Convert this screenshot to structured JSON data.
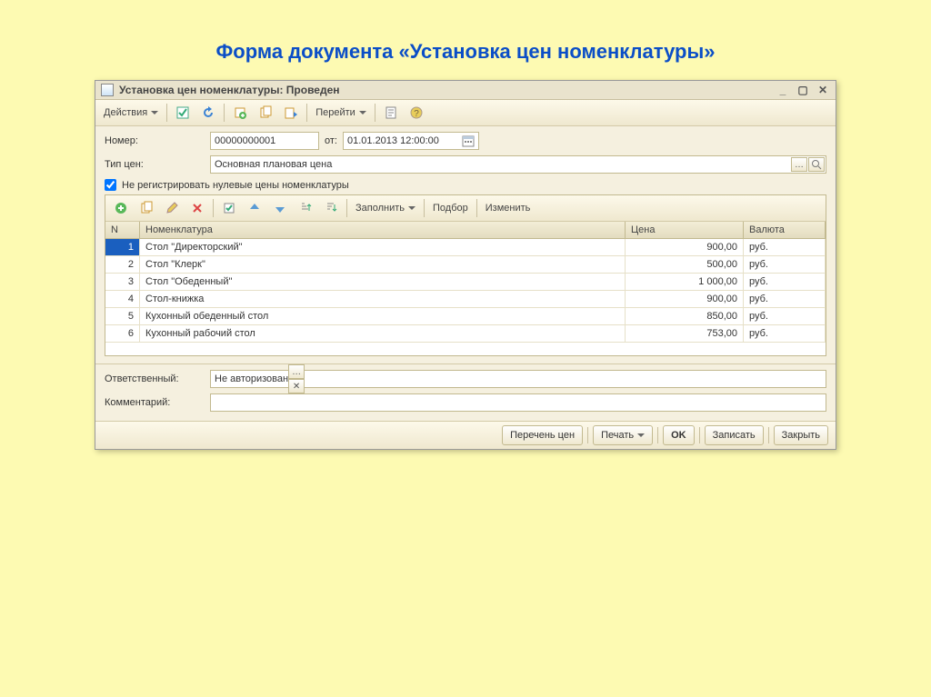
{
  "caption": "Форма документа «Установка цен номенклатуры»",
  "window": {
    "title": "Установка цен номенклатуры: Проведен"
  },
  "toolbar": {
    "actions": "Действия",
    "goto": "Перейти"
  },
  "fields": {
    "number_label": "Номер:",
    "number_value": "00000000001",
    "from_label": "от:",
    "date_value": "01.01.2013 12:00:00",
    "pricetype_label": "Тип цен:",
    "pricetype_value": "Основная плановая цена",
    "nozeroprices_label": "Не регистрировать нулевые цены номенклатуры",
    "responsible_label": "Ответственный:",
    "responsible_value": "Не авторизован",
    "comment_label": "Комментарий:",
    "comment_value": ""
  },
  "grid_toolbar": {
    "fill": "Заполнить",
    "select": "Подбор",
    "change": "Изменить"
  },
  "grid": {
    "columns": {
      "n": "N",
      "item": "Номенклатура",
      "price": "Цена",
      "currency": "Валюта"
    },
    "rows": [
      {
        "n": "1",
        "item": "Стол \"Директорский\"",
        "price": "900,00",
        "currency": "руб."
      },
      {
        "n": "2",
        "item": "Стол \"Клерк\"",
        "price": "500,00",
        "currency": "руб."
      },
      {
        "n": "3",
        "item": "Стол \"Обеденный\"",
        "price": "1 000,00",
        "currency": "руб."
      },
      {
        "n": "4",
        "item": "Стол-книжка",
        "price": "900,00",
        "currency": "руб."
      },
      {
        "n": "5",
        "item": "Кухонный обеденный стол",
        "price": "850,00",
        "currency": "руб."
      },
      {
        "n": "6",
        "item": "Кухонный рабочий стол",
        "price": "753,00",
        "currency": "руб."
      }
    ]
  },
  "footer": {
    "pricelist": "Перечень цен",
    "print": "Печать",
    "ok": "OK",
    "save": "Записать",
    "close": "Закрыть"
  }
}
